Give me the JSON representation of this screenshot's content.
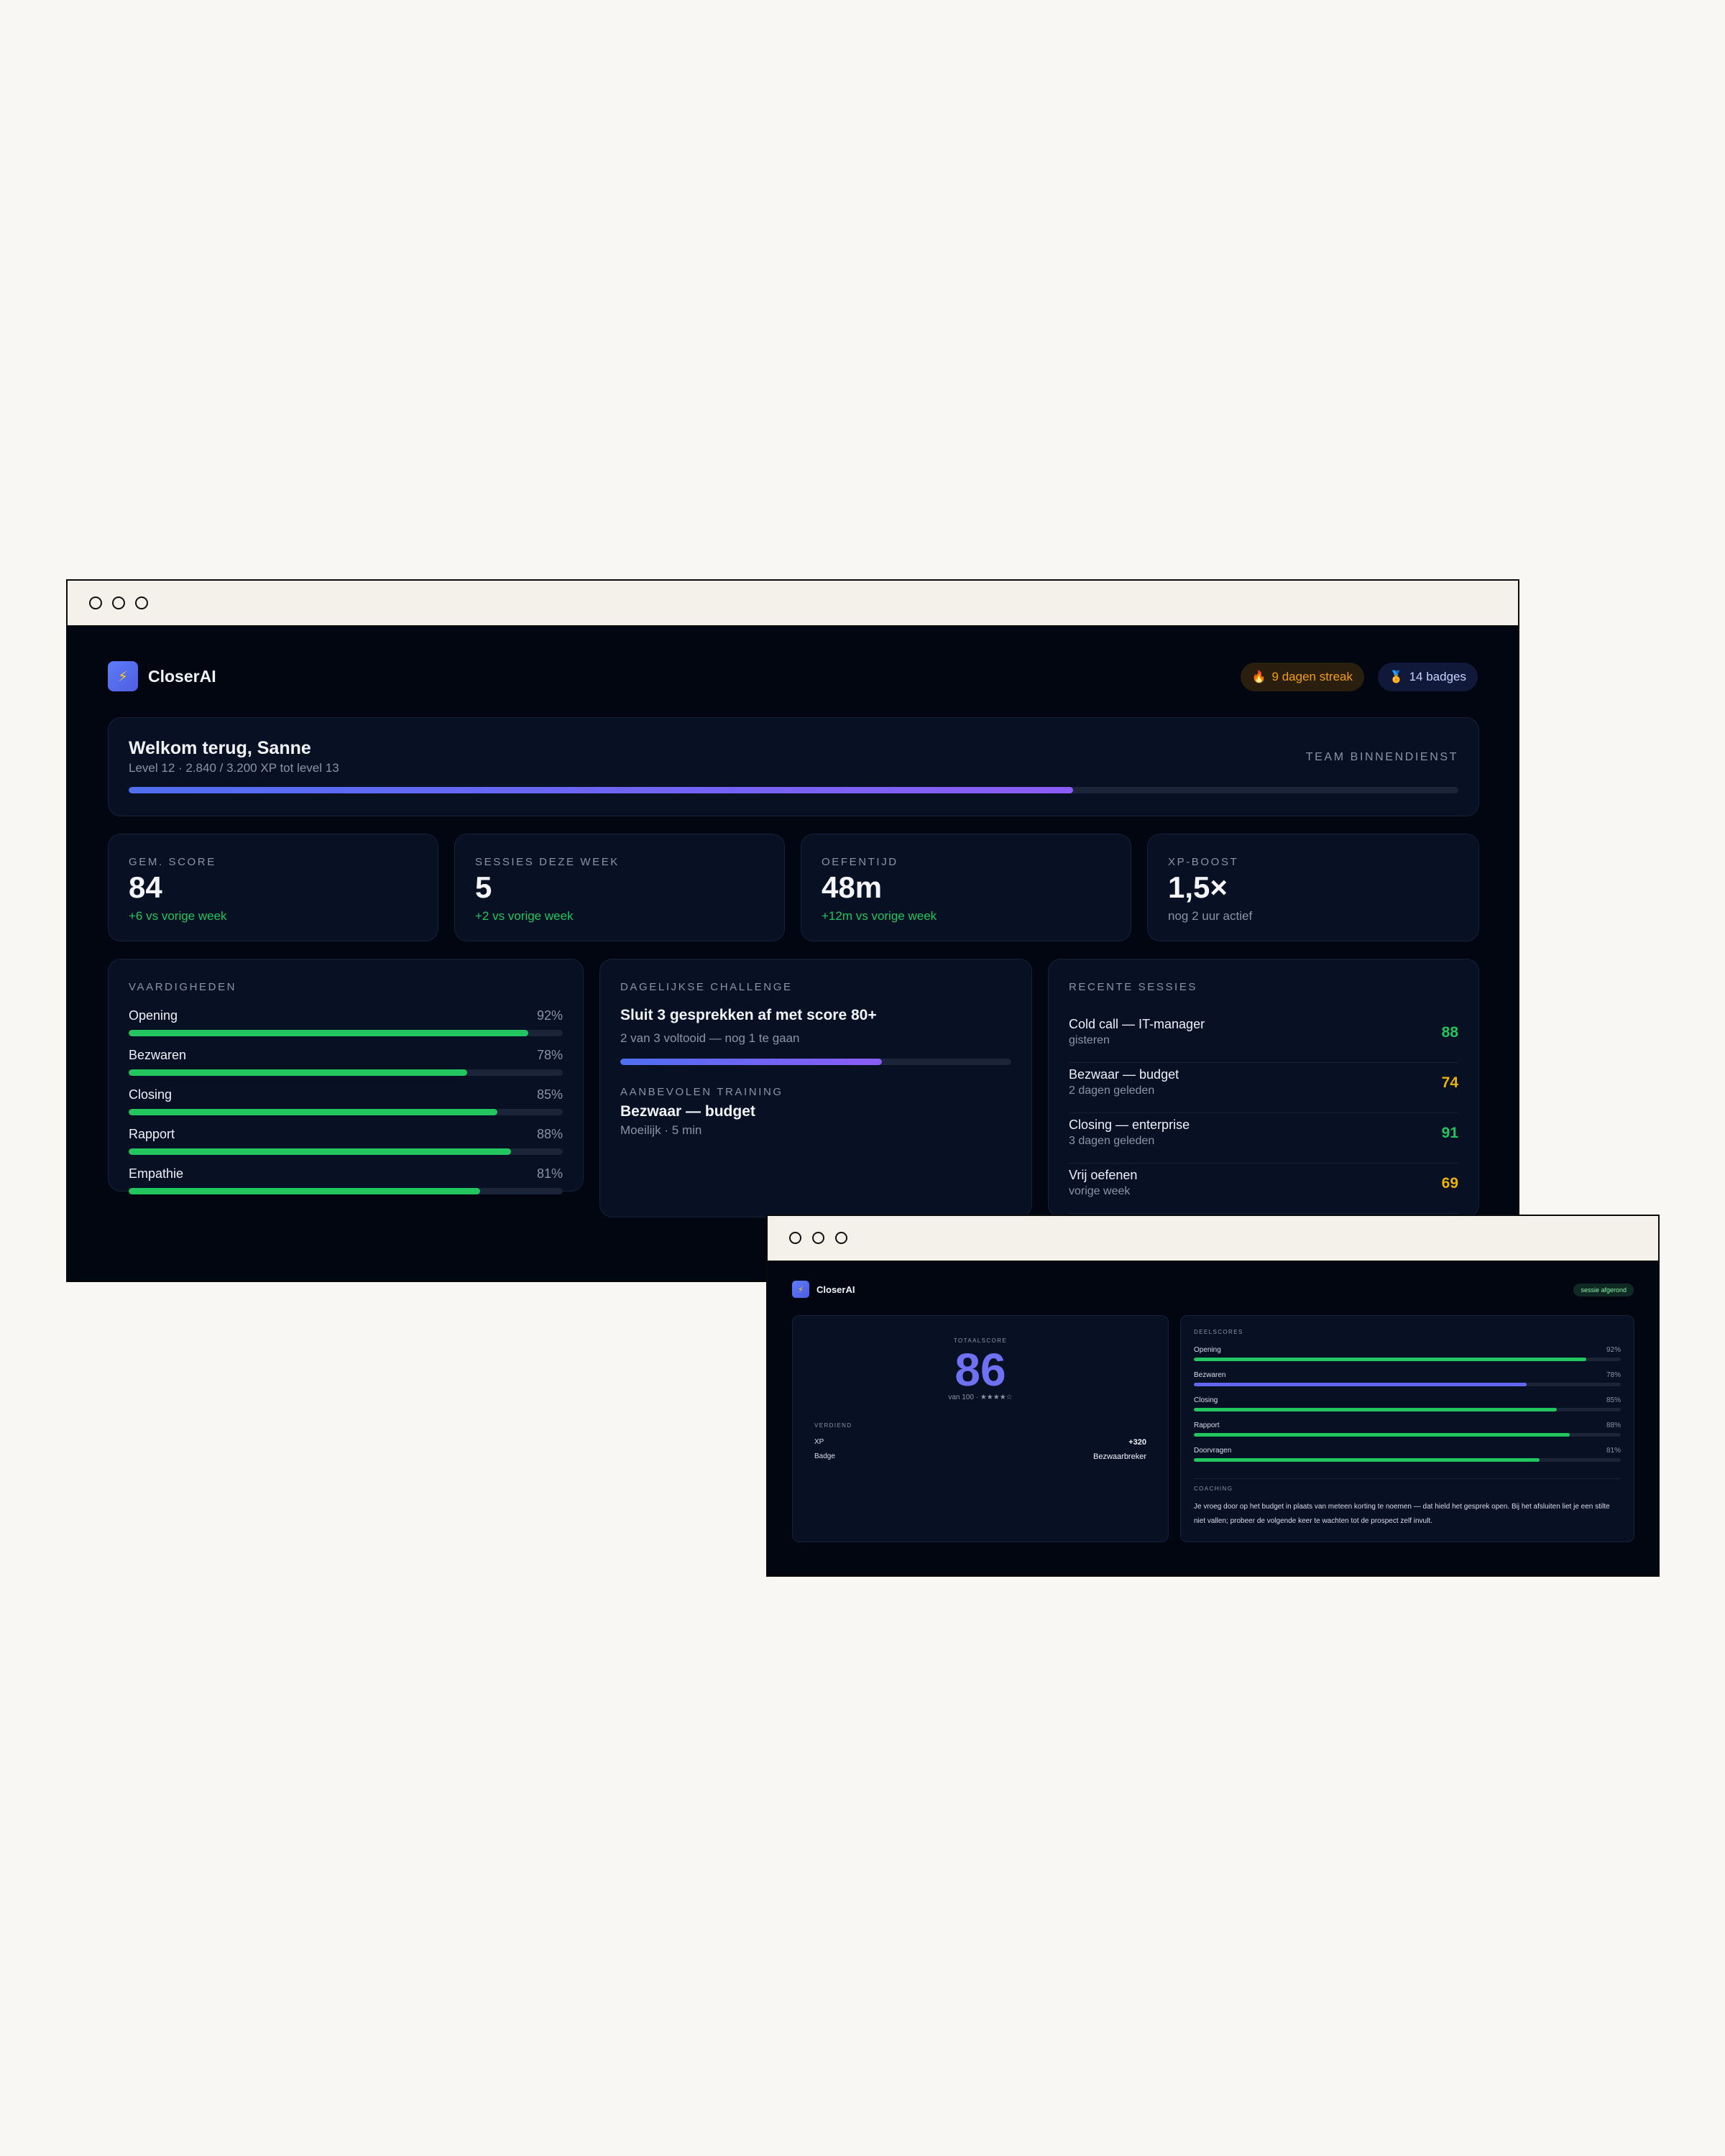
{
  "dashboard": {
    "app_name": "CloserAI",
    "streak_label": "9 dagen streak",
    "badges_label": "14 badges",
    "welcome": {
      "title": "Welkom terug, Sanne",
      "subtitle": "Level 12 · 2.840 / 3.200 XP tot level 13",
      "team": "TEAM BINNENDIENST",
      "xp_progress": 0.71
    },
    "stats": [
      {
        "label": "GEM. SCORE",
        "value": "84",
        "delta": "+6 vs vorige week",
        "tone": "green"
      },
      {
        "label": "SESSIES DEZE WEEK",
        "value": "5",
        "delta": "+2 vs vorige week",
        "tone": "green"
      },
      {
        "label": "OEFENTIJD",
        "value": "48m",
        "delta": "+12m vs vorige week",
        "tone": "green"
      },
      {
        "label": "XP-BOOST",
        "value": "1,5×",
        "delta": "nog 2 uur actief",
        "tone": "muted"
      }
    ],
    "skills": {
      "title": "VAARDIGHEDEN",
      "items": [
        {
          "label": "Opening",
          "pct_label": "92%",
          "value": 0.92
        },
        {
          "label": "Bezwaren",
          "pct_label": "78%",
          "value": 0.78
        },
        {
          "label": "Closing",
          "pct_label": "85%",
          "value": 0.85
        },
        {
          "label": "Rapport",
          "pct_label": "88%",
          "value": 0.88
        },
        {
          "label": "Empathie",
          "pct_label": "81%",
          "value": 0.81
        }
      ]
    },
    "challenge": {
      "title": "DAGELIJKSE CHALLENGE",
      "headline": "Sluit 3 gesprekken af met score 80+",
      "progress_text": "2 van 3 voltooid — nog 1 te gaan",
      "progress": 0.67,
      "recommended_title": "AANBEVOLEN TRAINING",
      "recommended_name": "Bezwaar — budget",
      "recommended_meta": "Moeilijk · 5 min"
    },
    "recent": {
      "title": "RECENTE SESSIES",
      "items": [
        {
          "title": "Cold call — IT-manager",
          "when": "gisteren",
          "score": "88",
          "tone": "green"
        },
        {
          "title": "Bezwaar — budget",
          "when": "2 dagen geleden",
          "score": "74",
          "tone": "amber"
        },
        {
          "title": "Closing — enterprise",
          "when": "3 dagen geleden",
          "score": "91",
          "tone": "green"
        },
        {
          "title": "Vrij oefenen",
          "when": "vorige week",
          "score": "69",
          "tone": "amber"
        }
      ]
    }
  },
  "result": {
    "app_name": "CloserAI",
    "status_badge": "sessie afgerond",
    "total_label": "TOTAALSCORE",
    "total_value": "86",
    "total_sub": "van 100 · ★★★★☆",
    "earned_title": "VERDIEND",
    "earned": [
      {
        "label": "XP",
        "value": "+320"
      },
      {
        "label": "Badge",
        "value": "Bezwaarbreker"
      }
    ],
    "subscores_title": "DEELSCORES",
    "subscores": [
      {
        "label": "Opening",
        "pct_label": "92%",
        "value": 0.92,
        "color": "green"
      },
      {
        "label": "Bezwaren",
        "pct_label": "78%",
        "value": 0.78,
        "color": "indigo"
      },
      {
        "label": "Closing",
        "pct_label": "85%",
        "value": 0.85,
        "color": "green"
      },
      {
        "label": "Rapport",
        "pct_label": "88%",
        "value": 0.88,
        "color": "green"
      },
      {
        "label": "Doorvragen",
        "pct_label": "81%",
        "value": 0.81,
        "color": "green"
      }
    ],
    "coaching_title": "COACHING",
    "coaching_text": "Je vroeg door op het budget in plaats van meteen korting te noemen — dat hield het gesprek open. Bij het afsluiten liet je een stilte niet vallen; probeer de volgende keer te wachten tot de prospect zelf invult."
  },
  "colors": {
    "accent": "#6366f1",
    "success": "#22c55e",
    "warning": "#eab308",
    "background": "#020611",
    "card": "#081024"
  }
}
